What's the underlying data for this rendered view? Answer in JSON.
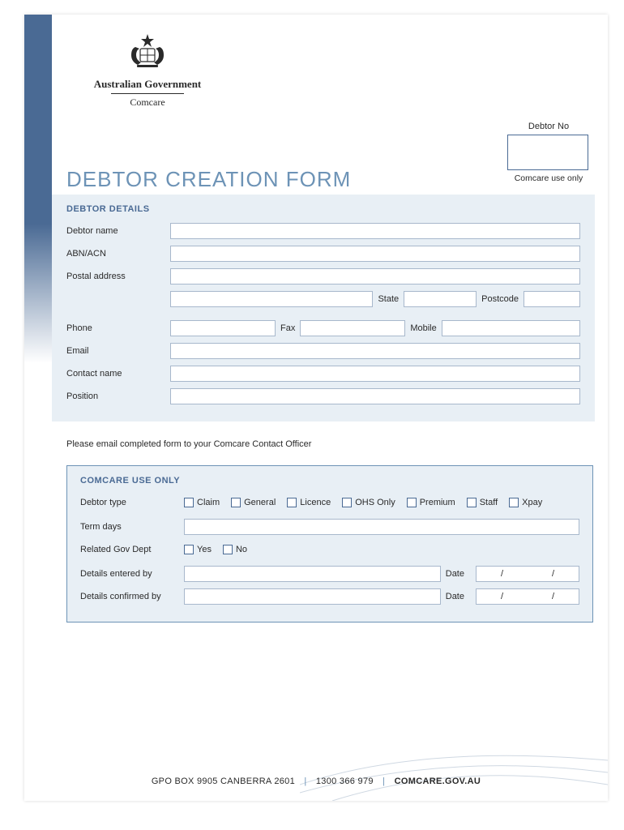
{
  "header": {
    "gov": "Australian Government",
    "agency": "Comcare"
  },
  "debtor_no": {
    "label": "Debtor No",
    "sub": "Comcare use only"
  },
  "title": "DEBTOR CREATION FORM",
  "details": {
    "section": "DEBTOR DETAILS",
    "debtor_name": "Debtor name",
    "abn": "ABN/ACN",
    "postal": "Postal address",
    "state": "State",
    "postcode": "Postcode",
    "phone": "Phone",
    "fax": "Fax",
    "mobile": "Mobile",
    "email": "Email",
    "contact": "Contact name",
    "position": "Position"
  },
  "instruction": "Please email completed form to your Comcare Contact Officer",
  "comcare": {
    "section": "COMCARE USE ONLY",
    "debtor_type": "Debtor type",
    "types": [
      "Claim",
      "General",
      "Licence",
      "OHS Only",
      "Premium",
      "Staff",
      "Xpay"
    ],
    "term_days": "Term days",
    "related_gov": "Related Gov Dept",
    "yes": "Yes",
    "no": "No",
    "entered_by": "Details entered by",
    "confirmed_by": "Details confirmed by",
    "date": "Date",
    "date_fmt": "/          /"
  },
  "footer": {
    "address": "GPO BOX 9905 CANBERRA 2601",
    "phone": "1300 366 979",
    "web": "COMCARE.GOV.AU"
  }
}
